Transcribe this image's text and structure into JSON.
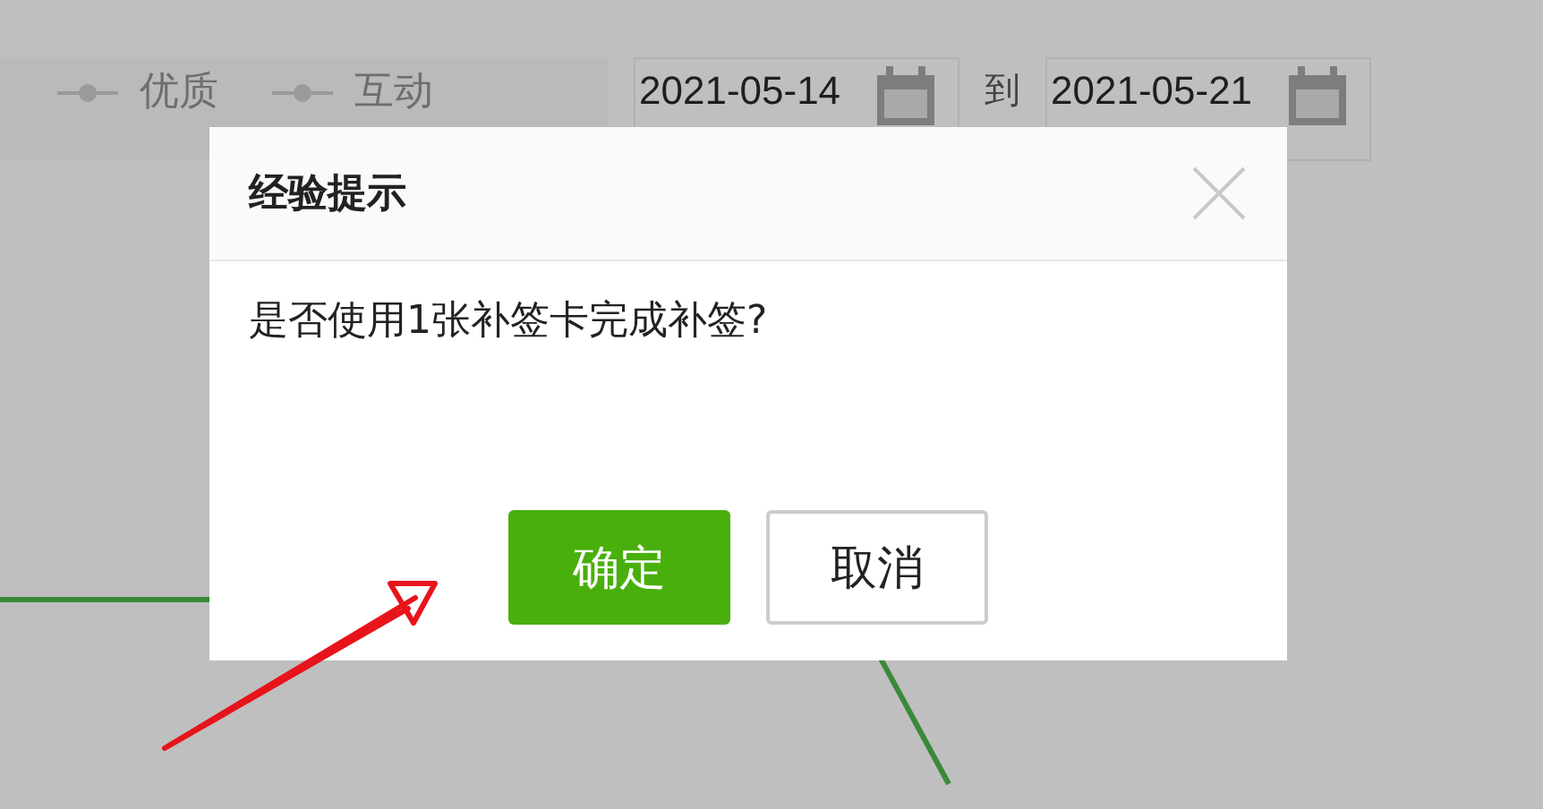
{
  "legend": [
    {
      "label": "优质"
    },
    {
      "label": "互动"
    }
  ],
  "date_range": {
    "start": "2021-05-14",
    "separator": "到",
    "end": "2021-05-21"
  },
  "dialog": {
    "title": "经验提示",
    "message": "是否使用1张补签卡完成补签?",
    "buttons": [
      {
        "label": "确定",
        "kind": "primary"
      },
      {
        "label": "取消",
        "kind": "default"
      }
    ]
  }
}
